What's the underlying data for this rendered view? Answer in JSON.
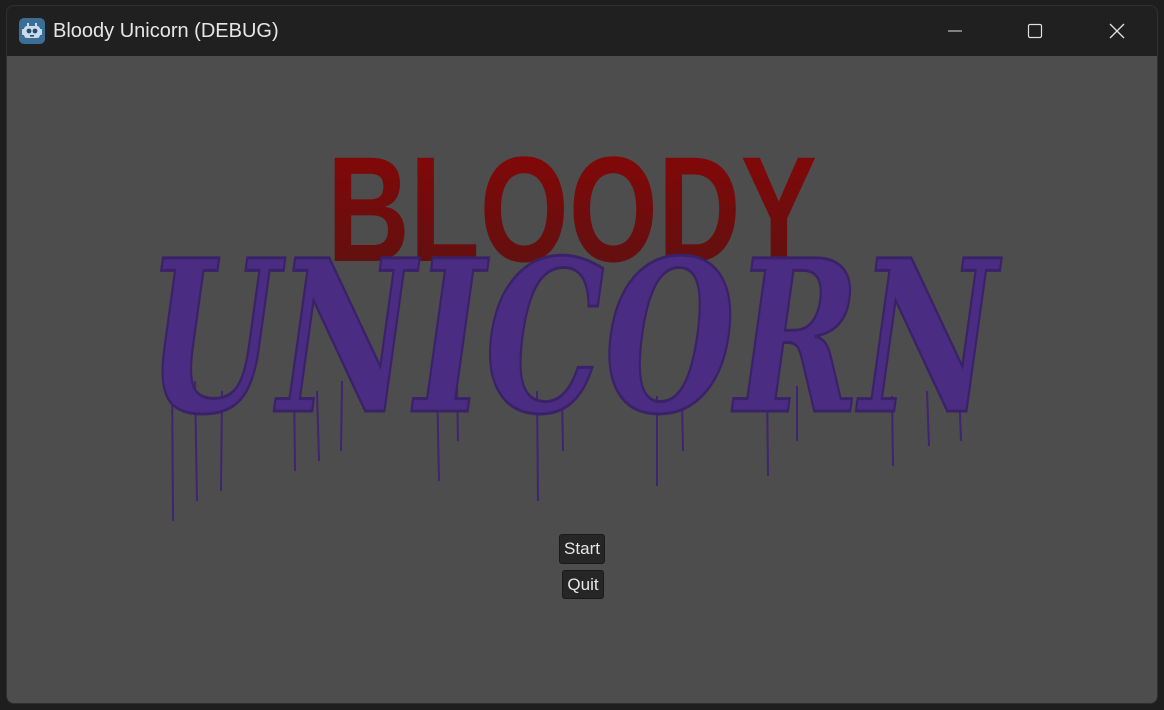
{
  "window": {
    "title": "Bloody Unicorn (DEBUG)",
    "icon": "godot-robot-icon",
    "controls": [
      "minimize-icon",
      "maximize-icon",
      "close-icon"
    ]
  },
  "logo": {
    "line1": "BLOODY",
    "line2": "UNICORN",
    "line1_color": "#8b0a0a",
    "line2_color": "#4a2d82"
  },
  "menu": {
    "start_label": "Start",
    "quit_label": "Quit"
  },
  "colors": {
    "background": "#4d4d4d",
    "titlebar": "#202020",
    "button_bg": "#262626"
  }
}
